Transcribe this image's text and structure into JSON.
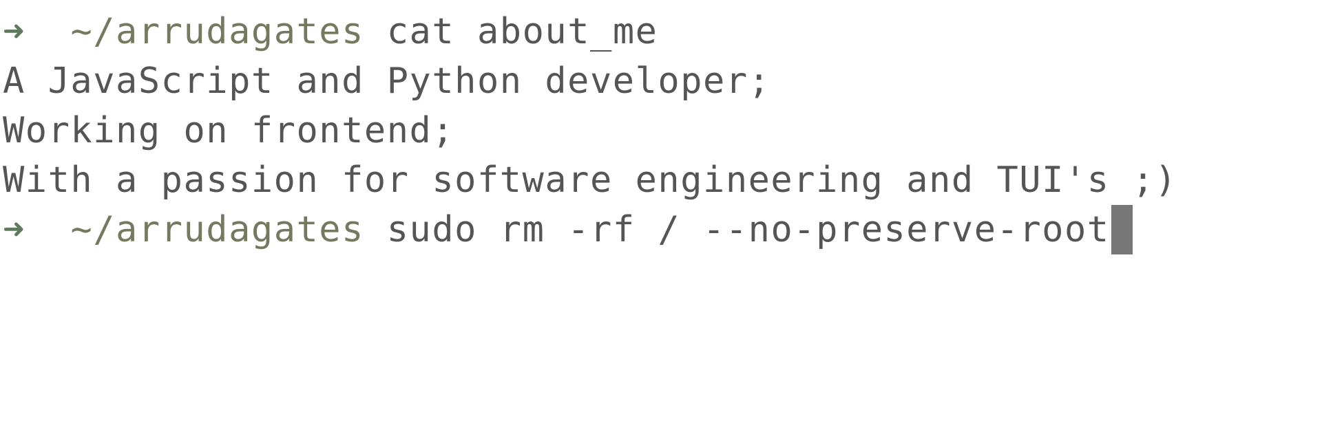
{
  "terminal": {
    "colors": {
      "prompt_arrow": "#5f7a5c",
      "prompt_path": "#76795f",
      "text": "#555555",
      "cursor": "#777777",
      "background": "#ffffff"
    },
    "line1": {
      "arrow": "➜",
      "path": "~/arrudagates",
      "command": "cat about_me"
    },
    "output": [
      "A JavaScript and Python developer;",
      "Working on frontend;",
      "With a passion for software engineering and TUI's ;)"
    ],
    "line2": {
      "arrow": "➜",
      "path": "~/arrudagates",
      "command": "sudo rm -rf / --no-preserve-root"
    }
  }
}
